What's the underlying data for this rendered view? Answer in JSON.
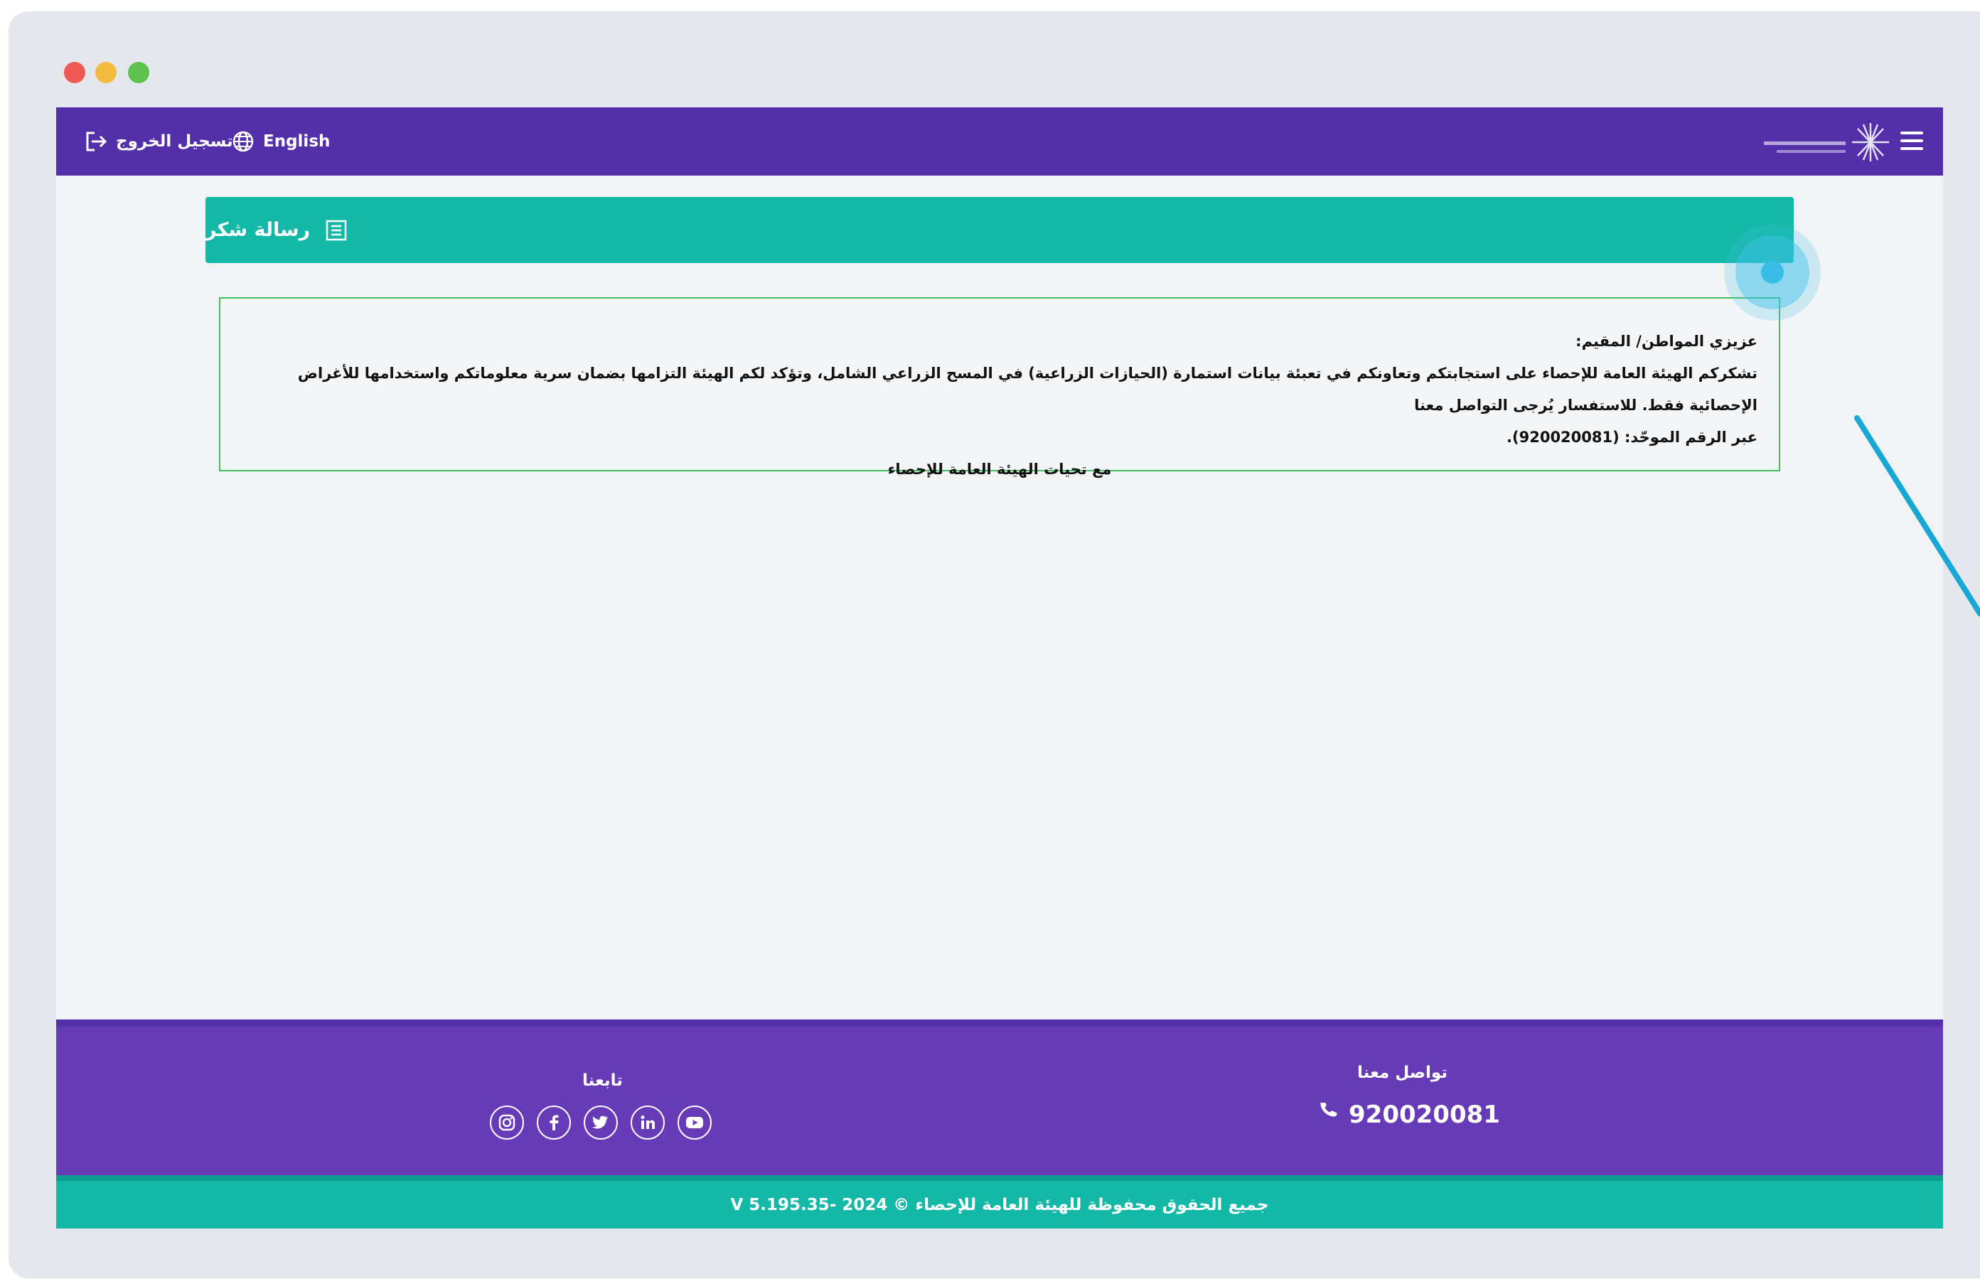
{
  "header": {
    "logout_label": "تسجيل الخروج",
    "language_label": "English"
  },
  "page": {
    "title": "رسالة شكر"
  },
  "message": {
    "greeting": "عزيزي المواطن/ المقيم:",
    "body_line1": "تشكركم الهيئة العامة للإحصاء على استجابتكم وتعاونكم في تعبئة بيانات استمارة (الحيازات الزراعية) في المسح الزراعي الشامل، وتؤكد لكم الهيئة التزامها بضمان سرية معلوماتكم واستخدامها للأغراض الإحصائية فقط. للاستفسار يُرجى التواصل معنا",
    "body_line2": "عبر الرقم الموحّد: (920020081).",
    "signature": "مع تحيات الهيئة العامة للإحصاء"
  },
  "footer": {
    "follow_title": "تابعنا",
    "contact_title": "تواصل معنا",
    "phone": "920020081",
    "copyright": "جميع الحقوق محفوظة للهيئة العامة للإحصاء © 2024 -V 5.195.35"
  },
  "colors": {
    "header_bg": "#532fa9",
    "title_bar_bg": "#14b8a6",
    "footer_bg": "#673ab7",
    "copyright_bg": "#14b8a6",
    "message_border": "#3fbf63",
    "click_indicator": "#39bde6"
  },
  "icons": {
    "menu": "menu-icon",
    "logout": "logout-icon",
    "language": "globe-icon",
    "title": "list-icon",
    "phone": "phone-icon",
    "socials": [
      "youtube-icon",
      "linkedin-icon",
      "twitter-icon",
      "facebook-icon",
      "instagram-icon"
    ]
  }
}
